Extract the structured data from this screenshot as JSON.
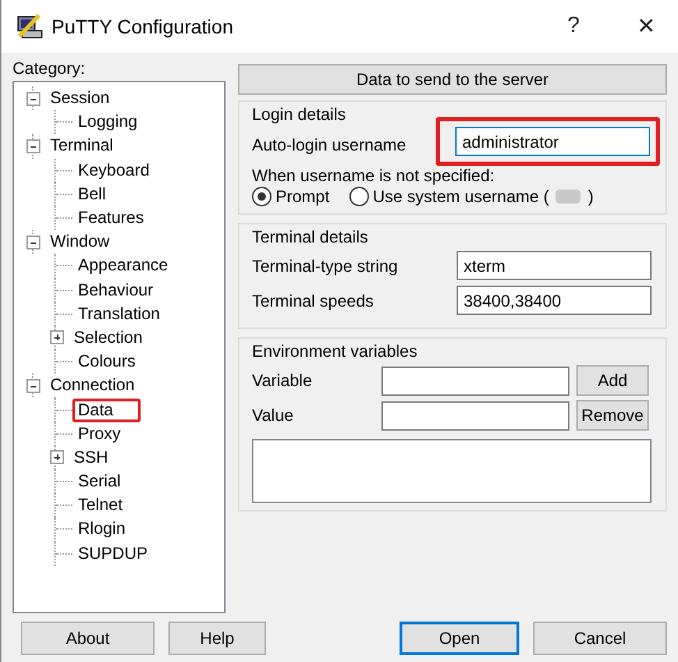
{
  "window": {
    "title": "PuTTY Configuration",
    "help_button": "?",
    "close_button": "✕"
  },
  "category": {
    "label": "Category:",
    "tree": [
      {
        "label": "Session",
        "expanded": true,
        "highlighted": false,
        "children": [
          {
            "label": "Logging",
            "highlighted": false
          }
        ]
      },
      {
        "label": "Terminal",
        "expanded": true,
        "highlighted": false,
        "children": [
          {
            "label": "Keyboard",
            "highlighted": false
          },
          {
            "label": "Bell",
            "highlighted": false
          },
          {
            "label": "Features",
            "highlighted": false
          }
        ]
      },
      {
        "label": "Window",
        "expanded": true,
        "highlighted": false,
        "children": [
          {
            "label": "Appearance",
            "highlighted": false
          },
          {
            "label": "Behaviour",
            "highlighted": false
          },
          {
            "label": "Translation",
            "highlighted": false
          },
          {
            "label": "Selection",
            "expanded": false,
            "highlighted": false
          },
          {
            "label": "Colours",
            "highlighted": false
          }
        ]
      },
      {
        "label": "Connection",
        "expanded": true,
        "highlighted": false,
        "children": [
          {
            "label": "Data",
            "highlighted": true
          },
          {
            "label": "Proxy",
            "highlighted": false
          },
          {
            "label": "SSH",
            "expanded": false,
            "highlighted": false
          },
          {
            "label": "Serial",
            "highlighted": false
          },
          {
            "label": "Telnet",
            "highlighted": false
          },
          {
            "label": "Rlogin",
            "highlighted": false
          },
          {
            "label": "SUPDUP",
            "highlighted": false
          }
        ]
      }
    ]
  },
  "panel": {
    "header": "Data to send to the server",
    "login": {
      "title": "Login details",
      "username_label": "Auto-login username",
      "username_value": "administrator",
      "username_highlighted": true,
      "when_label": "When username is not specified:",
      "options": [
        {
          "label": "Prompt",
          "selected": true
        },
        {
          "label": "Use system username (",
          "label_end": ")",
          "redacted": true,
          "selected": false
        }
      ]
    },
    "terminal": {
      "title": "Terminal details",
      "fields": [
        {
          "label": "Terminal-type string",
          "value": "xterm"
        },
        {
          "label": "Terminal speeds",
          "value": "38400,38400"
        }
      ]
    },
    "environment": {
      "title": "Environment variables",
      "variable_label": "Variable",
      "value_label": "Value",
      "add_button": "Add",
      "remove_button": "Remove"
    }
  },
  "buttons": {
    "about": "About",
    "help": "Help",
    "open": "Open",
    "cancel": "Cancel"
  }
}
